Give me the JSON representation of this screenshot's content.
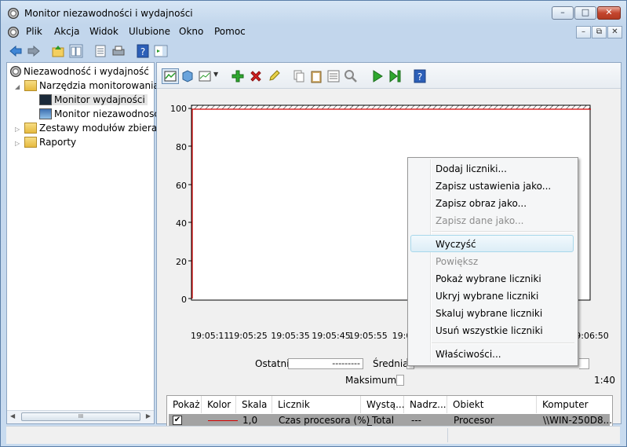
{
  "window": {
    "title": "Monitor niezawodności i wydajności"
  },
  "caption_buttons": {
    "minimize": "–",
    "maximize": "□",
    "close": "✕"
  },
  "menu": [
    "Plik",
    "Akcja",
    "Widok",
    "Ulubione",
    "Okno",
    "Pomoc"
  ],
  "mdi_buttons": {
    "minimize": "–",
    "restore": "⧉",
    "close": "✕"
  },
  "tree": {
    "root": "Niezawodność i wydajność",
    "tools": "Narzędzia monitorowania",
    "perf_monitor": "Monitor wydajności",
    "rel_monitor": "Monitor niezawodnosc",
    "collector_sets": "Zestawy modułów zbierają",
    "reports": "Raporty"
  },
  "scrollbar": {
    "grip": "III"
  },
  "chart_data": {
    "type": "line",
    "y_ticks": [
      "100",
      "80",
      "60",
      "40",
      "20",
      "0"
    ],
    "ylim": [
      0,
      100
    ],
    "x_ticks": [
      "19:05:11",
      "19:05:25",
      "19:05:35",
      "19:05:45",
      "19:05:55",
      "19:0",
      "19:06:50"
    ],
    "series": [
      {
        "values": [
          0,
          100,
          100
        ]
      }
    ]
  },
  "stats": {
    "last_label": "Ostatni",
    "last_value": "---------",
    "average_label": "Średnia",
    "max_label": "Maksimum",
    "duration_value": "1:40"
  },
  "table": {
    "headers": [
      "Pokaż",
      "Kolor",
      "Skala",
      "Licznik",
      "Wystą...",
      "Nadrz...",
      "Obiekt",
      "Komputer"
    ],
    "row": {
      "show": "✔",
      "scale": "1,0",
      "counter": "Czas procesora (%)",
      "instance": "_Total",
      "parent": "---",
      "object": "Procesor",
      "computer": "\\\\WIN-250D8..."
    },
    "row_color": "#d40000"
  },
  "context_menu": {
    "add": "Dodaj liczniki...",
    "save_settings": "Zapisz ustawienia jako...",
    "save_image": "Zapisz obraz jako...",
    "save_data": "Zapisz dane jako...",
    "clear": "Wyczyść",
    "zoom": "Powiększ",
    "show_selected": "Pokaż wybrane liczniki",
    "hide_selected": "Ukryj wybrane liczniki",
    "scale_selected": "Skaluj wybrane liczniki",
    "remove_all": "Usuń wszystkie liczniki",
    "properties": "Właściwości..."
  }
}
